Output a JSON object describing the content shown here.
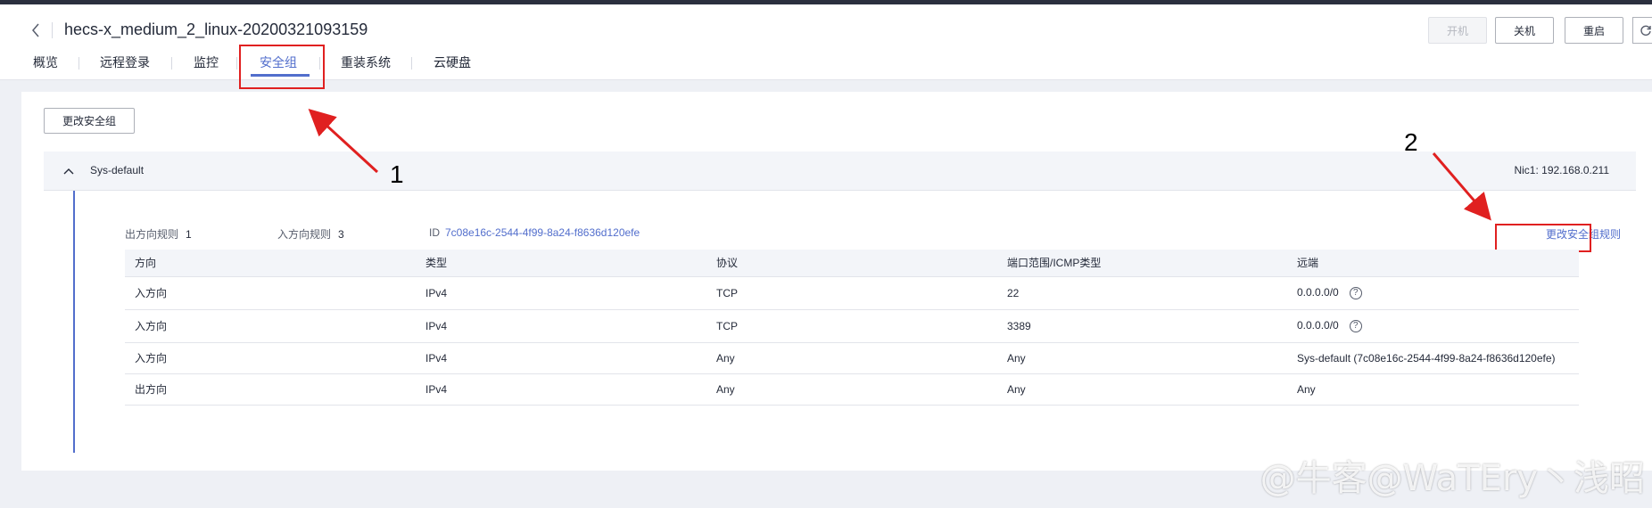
{
  "header": {
    "title": "hecs-x_medium_2_linux-20200321093159",
    "buttons": {
      "start": "开机",
      "shutdown": "关机",
      "restart": "重启"
    }
  },
  "tabs": [
    {
      "label": "概览"
    },
    {
      "label": "远程登录"
    },
    {
      "label": "监控"
    },
    {
      "label": "安全组"
    },
    {
      "label": "重装系统"
    },
    {
      "label": "云硬盘"
    }
  ],
  "main": {
    "change_sg_label": "更改安全组",
    "security_group": {
      "name": "Sys-default",
      "nic": "Nic1: 192.168.0.211",
      "outbound_label": "出方向规则",
      "outbound_count": "1",
      "inbound_label": "入方向规则",
      "inbound_count": "3",
      "id_label": "ID",
      "id_value": "7c08e16c-2544-4f99-8a24-f8636d120efe",
      "modify_rules_label": "更改安全组规则"
    },
    "table": {
      "headers": [
        "方向",
        "类型",
        "协议",
        "端口范围/ICMP类型",
        "远端"
      ],
      "rows": [
        [
          "入方向",
          "IPv4",
          "TCP",
          "22",
          "0.0.0.0/0"
        ],
        [
          "入方向",
          "IPv4",
          "TCP",
          "3389",
          "0.0.0.0/0"
        ],
        [
          "入方向",
          "IPv4",
          "Any",
          "Any",
          "Sys-default (7c08e16c-2544-4f99-8a24-f8636d120efe)"
        ],
        [
          "出方向",
          "IPv4",
          "Any",
          "Any",
          "Any"
        ]
      ]
    }
  },
  "annotations": {
    "one": "1",
    "two": "2"
  },
  "watermark": "@牛客@WaTEry丶浅昭",
  "colors": {
    "accent": "#526ecc",
    "highlight": "#e02020"
  }
}
